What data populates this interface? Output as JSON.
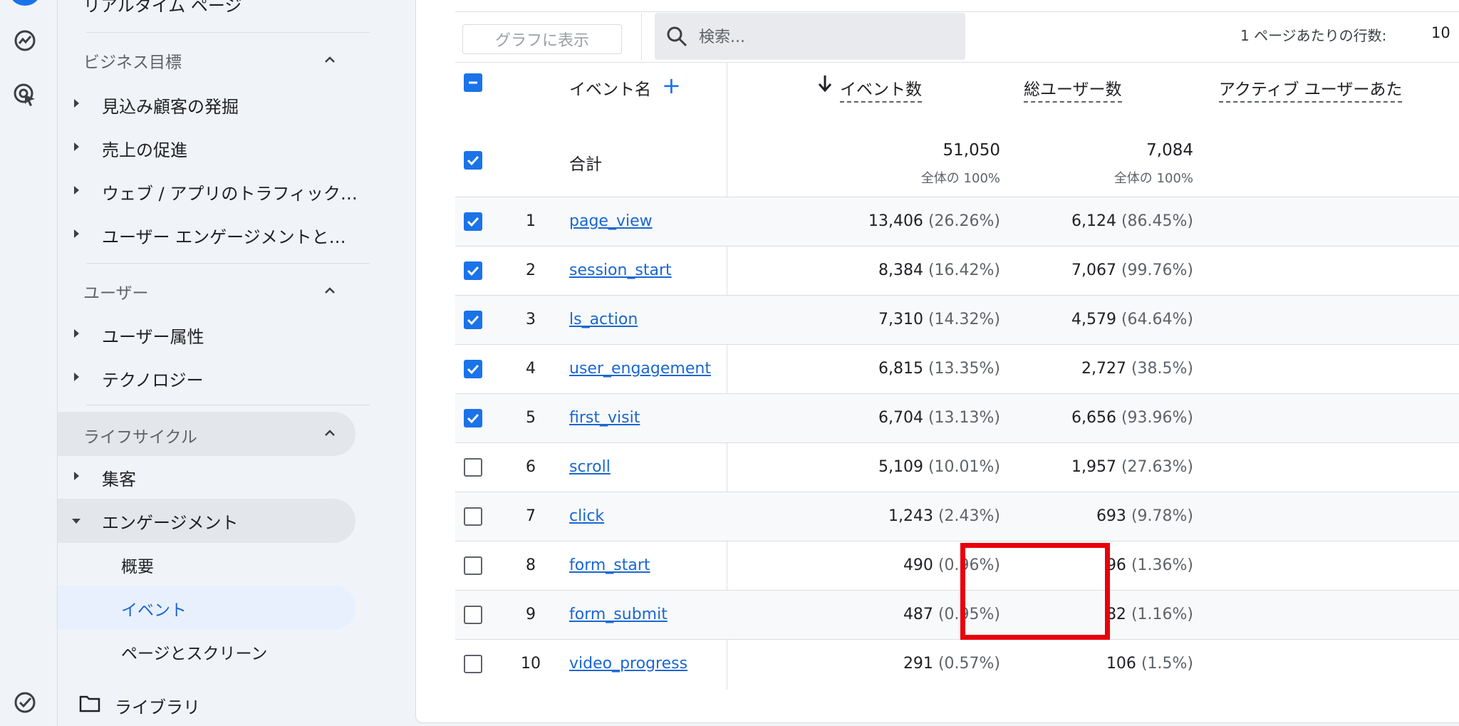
{
  "sidebar": {
    "top_item": "リアルタイム ページ",
    "sections": [
      {
        "heading": "ビジネス目標",
        "items": [
          "見込み顧客の発掘",
          "売上の促進",
          "ウェブ / アプリのトラフィック…",
          "ユーザー エンゲージメントと…"
        ]
      },
      {
        "heading": "ユーザー",
        "items": [
          "ユーザー属性",
          "テクノロジー"
        ]
      },
      {
        "heading": "ライフサイクル",
        "items": [
          "集客",
          "エンゲージメント"
        ]
      }
    ],
    "engagement_children": [
      "概要",
      "イベント",
      "ページとスクリーン"
    ],
    "library": "ライブラリ"
  },
  "toolbar": {
    "graph_button": "グラフに表示",
    "search_placeholder": "検索...",
    "rows_per_page_label": "1 ページあたりの行数:",
    "rows_per_page_value": "10"
  },
  "table": {
    "headers": {
      "event_name": "イベント名",
      "event_count": "イベント数",
      "total_users": "総ユーザー数",
      "active_users": "アクティブ ユーザーあた"
    },
    "total": {
      "label": "合計",
      "event_count": "51,050",
      "event_count_sub": "全体の 100%",
      "total_users": "7,084",
      "total_users_sub": "全体の 100%"
    },
    "rows": [
      {
        "rank": "1",
        "name": "page_view",
        "count": "13,406",
        "count_pct": "(26.26%)",
        "users": "6,124",
        "users_pct": "(86.45%)",
        "checked": true
      },
      {
        "rank": "2",
        "name": "session_start",
        "count": "8,384",
        "count_pct": "(16.42%)",
        "users": "7,067",
        "users_pct": "(99.76%)",
        "checked": true
      },
      {
        "rank": "3",
        "name": "ls_action",
        "count": "7,310",
        "count_pct": "(14.32%)",
        "users": "4,579",
        "users_pct": "(64.64%)",
        "checked": true
      },
      {
        "rank": "4",
        "name": "user_engagement",
        "count": "6,815",
        "count_pct": "(13.35%)",
        "users": "2,727",
        "users_pct": "(38.5%)",
        "checked": true
      },
      {
        "rank": "5",
        "name": "first_visit",
        "count": "6,704",
        "count_pct": "(13.13%)",
        "users": "6,656",
        "users_pct": "(93.96%)",
        "checked": true
      },
      {
        "rank": "6",
        "name": "scroll",
        "count": "5,109",
        "count_pct": "(10.01%)",
        "users": "1,957",
        "users_pct": "(27.63%)",
        "checked": false
      },
      {
        "rank": "7",
        "name": "click",
        "count": "1,243",
        "count_pct": "(2.43%)",
        "users": "693",
        "users_pct": "(9.78%)",
        "checked": false
      },
      {
        "rank": "8",
        "name": "form_start",
        "count": "490",
        "count_pct": "(0.96%)",
        "users": "96",
        "users_pct": "(1.36%)",
        "checked": false
      },
      {
        "rank": "9",
        "name": "form_submit",
        "count": "487",
        "count_pct": "(0.95%)",
        "users": "82",
        "users_pct": "(1.16%)",
        "checked": false
      },
      {
        "rank": "10",
        "name": "video_progress",
        "count": "291",
        "count_pct": "(0.57%)",
        "users": "106",
        "users_pct": "(1.5%)",
        "checked": false
      }
    ]
  },
  "colors": {
    "accent": "#1a73e8",
    "link": "#1967d2",
    "highlight_box": "#e8000b"
  }
}
